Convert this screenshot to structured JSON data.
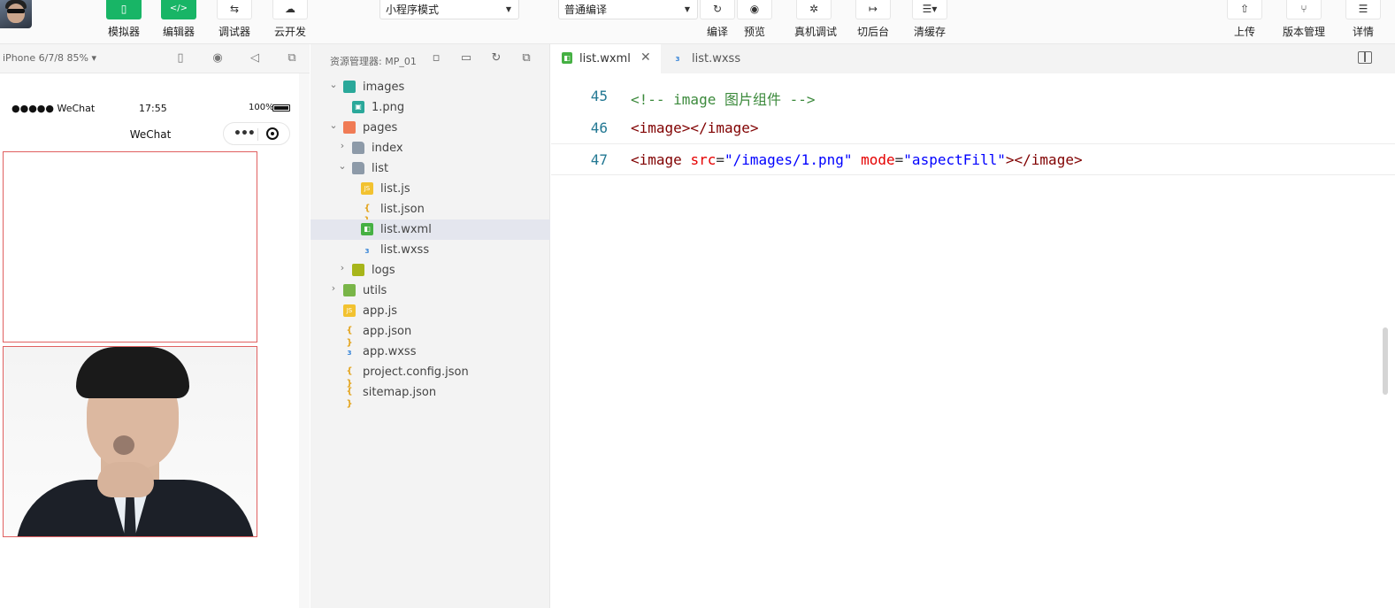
{
  "toolbar": {
    "simulator_label": "模拟器",
    "editor_label": "编辑器",
    "debugger_label": "调试器",
    "cloud_label": "云开发",
    "mode_select": "小程序模式",
    "compile_select": "普通编译",
    "compile_label": "编译",
    "preview_label": "预览",
    "remote_debug_label": "真机调试",
    "background_label": "切后台",
    "clear_cache_label": "清缓存",
    "upload_label": "上传",
    "version_label": "版本管理",
    "details_label": "详情"
  },
  "simulator": {
    "device": "iPhone 6/7/8 85%",
    "signal": "●●●●● WeChat",
    "time": "17:55",
    "battery": "100%",
    "nav_title": "WeChat",
    "capsule_dots": "•••"
  },
  "explorer": {
    "title": "资源管理器: MP_01",
    "items": [
      {
        "name": "images",
        "type": "folder-img",
        "depth": 0,
        "arrow": "open"
      },
      {
        "name": "1.png",
        "type": "png",
        "depth": 1,
        "arrow": ""
      },
      {
        "name": "pages",
        "type": "folder-pages",
        "depth": 0,
        "arrow": "open"
      },
      {
        "name": "index",
        "type": "folder",
        "depth": 1,
        "arrow": "closed"
      },
      {
        "name": "list",
        "type": "folder",
        "depth": 1,
        "arrow": "open"
      },
      {
        "name": "list.js",
        "type": "js",
        "depth": 2,
        "arrow": ""
      },
      {
        "name": "list.json",
        "type": "json",
        "depth": 2,
        "arrow": ""
      },
      {
        "name": "list.wxml",
        "type": "wxml",
        "depth": 2,
        "arrow": "",
        "active": true
      },
      {
        "name": "list.wxss",
        "type": "wxss",
        "depth": 2,
        "arrow": ""
      },
      {
        "name": "logs",
        "type": "folder-logs",
        "depth": 1,
        "arrow": "closed"
      },
      {
        "name": "utils",
        "type": "folder-utils",
        "depth": 0,
        "arrow": "closed"
      },
      {
        "name": "app.js",
        "type": "js",
        "depth": 0,
        "arrow": ""
      },
      {
        "name": "app.json",
        "type": "json",
        "depth": 0,
        "arrow": ""
      },
      {
        "name": "app.wxss",
        "type": "wxss",
        "depth": 0,
        "arrow": ""
      },
      {
        "name": "project.config.json",
        "type": "json",
        "depth": 0,
        "arrow": ""
      },
      {
        "name": "sitemap.json",
        "type": "json",
        "depth": 0,
        "arrow": ""
      }
    ]
  },
  "editor": {
    "tabs": [
      {
        "name": "list.wxml",
        "active": true
      },
      {
        "name": "list.wxss",
        "active": false
      }
    ],
    "lines": [
      {
        "num": "45",
        "tokens": [
          [
            "cmt",
            "<!-- image 图片组件 -->"
          ]
        ]
      },
      {
        "num": "46",
        "tokens": [
          [
            "tag",
            "<image></image>"
          ]
        ]
      },
      {
        "num": "47",
        "current": true,
        "tokens": [
          [
            "tag",
            "<image "
          ],
          [
            "attr",
            "src"
          ],
          [
            "eq",
            "="
          ],
          [
            "str",
            "\"/images/1.png\""
          ],
          [
            "eq",
            " "
          ],
          [
            "attr",
            "mode"
          ],
          [
            "eq",
            "="
          ],
          [
            "str",
            "\"aspectFill\""
          ],
          [
            "tag",
            "></image>"
          ]
        ]
      }
    ]
  }
}
